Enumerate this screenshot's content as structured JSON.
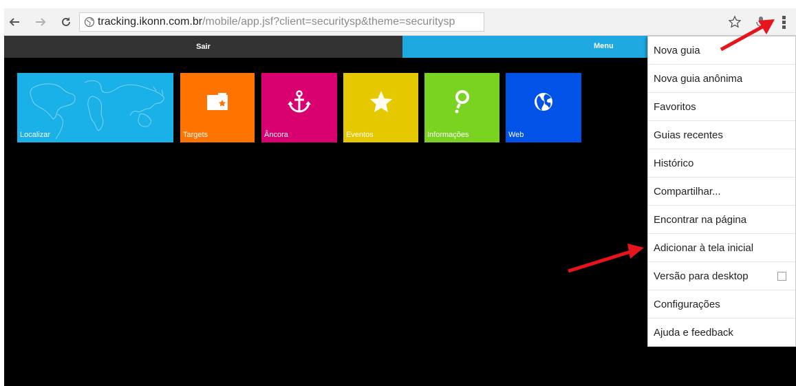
{
  "browser": {
    "url_host": "tracking.ikonn.com.br",
    "url_path": "/mobile/app.jsf?client=securitysp&theme=securitysp"
  },
  "page": {
    "topbar": {
      "left_label": "Sair",
      "right_label": "Menu"
    },
    "tiles": [
      {
        "label": "Localizar",
        "color": "#1ab1e8",
        "icon": "world-map-icon"
      },
      {
        "label": "Targets",
        "color": "#ff7300",
        "icon": "folder-star-icon"
      },
      {
        "label": "Âncora",
        "color": "#d9006f",
        "icon": "anchor-icon"
      },
      {
        "label": "Eventos",
        "color": "#e6c800",
        "icon": "star-icon"
      },
      {
        "label": "Informações",
        "color": "#7ad321",
        "icon": "info-balloon-icon"
      },
      {
        "label": "Web",
        "color": "#0053e6",
        "icon": "globe-icon"
      }
    ]
  },
  "overflow_menu": {
    "items": [
      {
        "label": "Nova guia"
      },
      {
        "label": "Nova guia anônima"
      },
      {
        "label": "Favoritos"
      },
      {
        "label": "Guias recentes"
      },
      {
        "label": "Histórico"
      },
      {
        "label": "Compartilhar..."
      },
      {
        "label": "Encontrar na página"
      },
      {
        "label": "Adicionar à tela inicial"
      },
      {
        "label": "Versão para desktop",
        "checkbox": false
      },
      {
        "label": "Configurações"
      },
      {
        "label": "Ajuda e feedback"
      }
    ]
  },
  "annotations": {
    "arrow_color": "#e8141b"
  }
}
